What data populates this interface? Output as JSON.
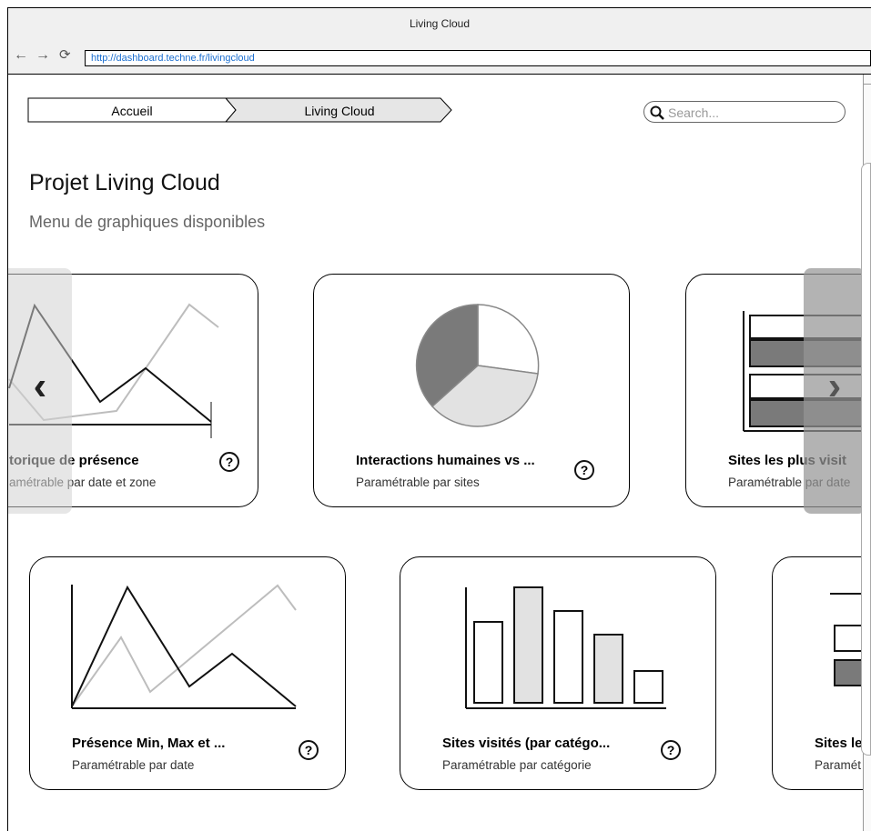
{
  "window": {
    "title": "Living Cloud"
  },
  "browser": {
    "url": "http://dashboard.techne.fr/livingcloud",
    "back_icon": "back-arrow-icon",
    "forward_icon": "forward-arrow-icon",
    "reload_icon": "reload-icon"
  },
  "breadcrumb": {
    "items": [
      {
        "label": "Accueil"
      },
      {
        "label": "Living Cloud"
      }
    ]
  },
  "search": {
    "placeholder": "Search..."
  },
  "page": {
    "title": "Projet Living Cloud",
    "subtitle": "Menu de graphiques disponibles"
  },
  "cards": [
    {
      "title": "torique de présence",
      "subtitle": "amétrable par date et zone",
      "icon": "line-chart-icon"
    },
    {
      "title": "Interactions humaines vs ...",
      "subtitle": "Paramétrable par sites",
      "icon": "pie-chart-icon"
    },
    {
      "title": "Sites les plus visit",
      "subtitle": "Paramétrable par date",
      "icon": "horizontal-bar-chart-icon"
    },
    {
      "title": "Présence Min, Max et ...",
      "subtitle": "Paramétrable par date",
      "icon": "line-chart-icon"
    },
    {
      "title": "Sites visités (par catégo...",
      "subtitle": "Paramétrable par catégorie",
      "icon": "bar-chart-icon"
    },
    {
      "title": "Sites le",
      "subtitle": "Paramét",
      "icon": "horizontal-bar-chart-icon"
    }
  ],
  "help_label": "?",
  "carousel": {
    "prev": "‹",
    "next": "›"
  },
  "colors": {
    "link": "#1a6ed0",
    "dark_fill": "#7a7a7a",
    "light_fill": "#e2e2e2"
  }
}
